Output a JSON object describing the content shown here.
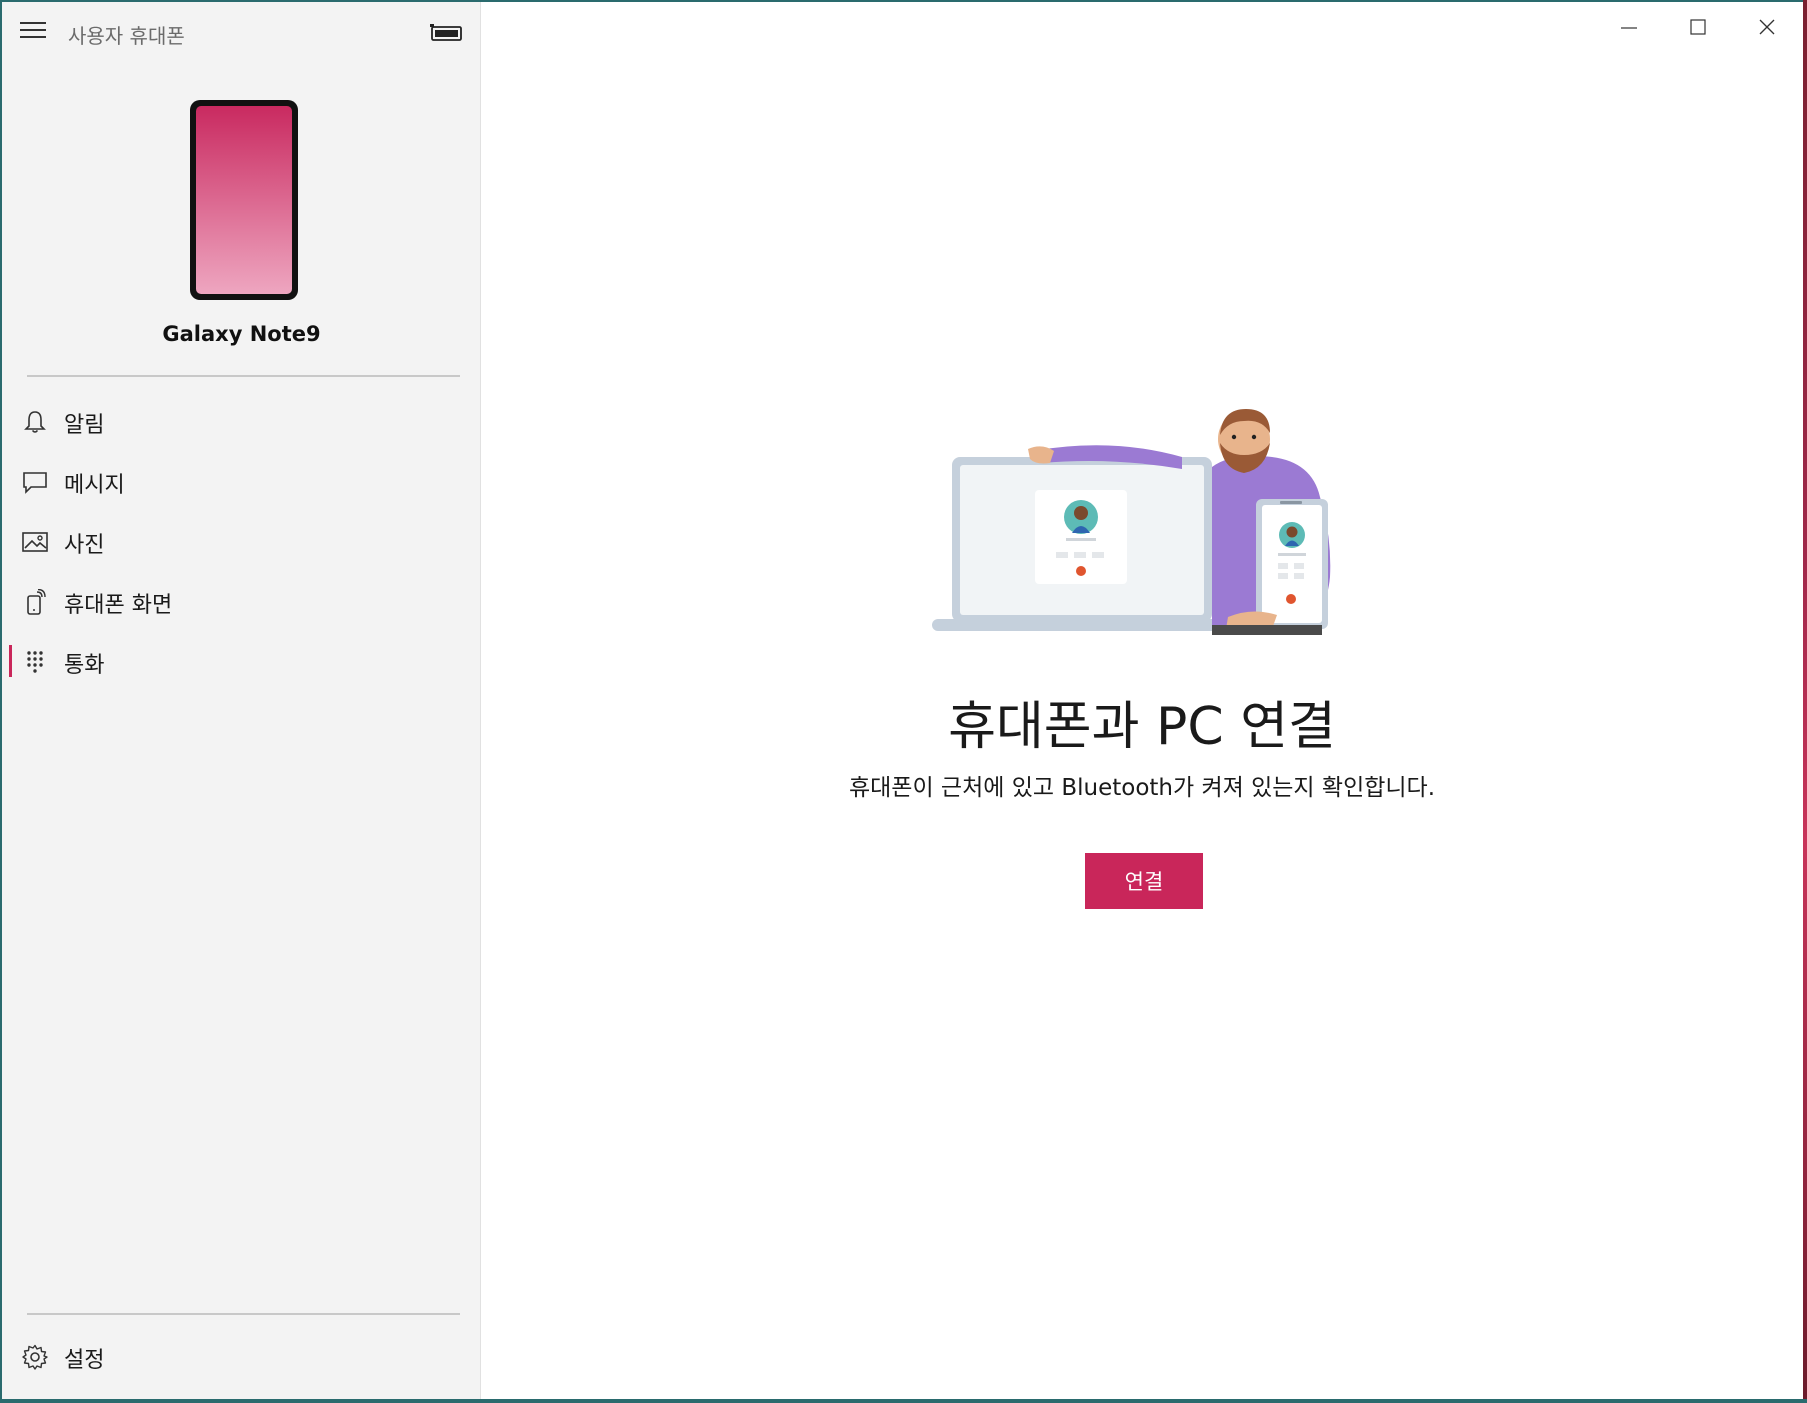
{
  "app": {
    "title": "사용자 휴대폰"
  },
  "device": {
    "name": "Galaxy Note9",
    "accent": "#c9265a"
  },
  "nav": {
    "items": [
      {
        "label": "알림",
        "icon": "bell-icon"
      },
      {
        "label": "메시지",
        "icon": "message-icon"
      },
      {
        "label": "사진",
        "icon": "photos-icon"
      },
      {
        "label": "휴대폰 화면",
        "icon": "phone-screen-icon"
      },
      {
        "label": "통화",
        "icon": "dialpad-icon",
        "active": true
      }
    ],
    "settings_label": "설정"
  },
  "main": {
    "headline": "휴대폰과 PC 연결",
    "subline": "휴대폰이 근처에 있고 Bluetooth가 켜져 있는지 확인합니다.",
    "connect_label": "연결"
  },
  "colors": {
    "accent": "#c9265a",
    "sidebar_bg": "#f3f3f3"
  }
}
